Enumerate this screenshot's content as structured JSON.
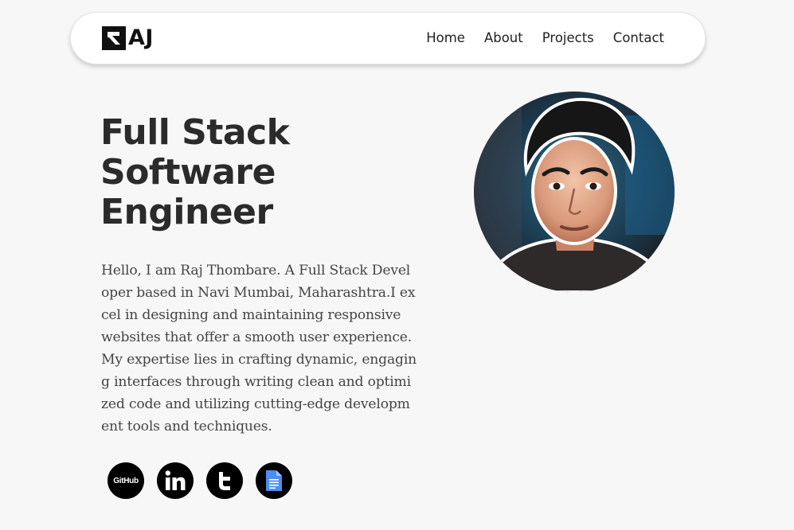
{
  "nav": {
    "logo_text": "AJ",
    "links": [
      "Home",
      "About",
      "Projects",
      "Contact"
    ]
  },
  "hero": {
    "title_lines": [
      "Full Stack",
      "Software",
      "Engineer"
    ],
    "bio": "Hello, I am Raj Thombare. A Full Stack Developer based in Navi Mumbai, Maharashtra.I excel in designing and maintaining responsive websites that offer a smooth user experience. My expertise lies in crafting dynamic, engaging interfaces through writing clean and optimized code and utilizing cutting-edge development tools and techniques."
  },
  "socials": {
    "github_label": "GitHub",
    "icons": [
      "github-icon",
      "linkedin-icon",
      "twitter-icon",
      "document-icon"
    ]
  },
  "colors": {
    "background": "#f8f7f8",
    "text": "#2b2b2b",
    "icon_bg": "#000000"
  }
}
